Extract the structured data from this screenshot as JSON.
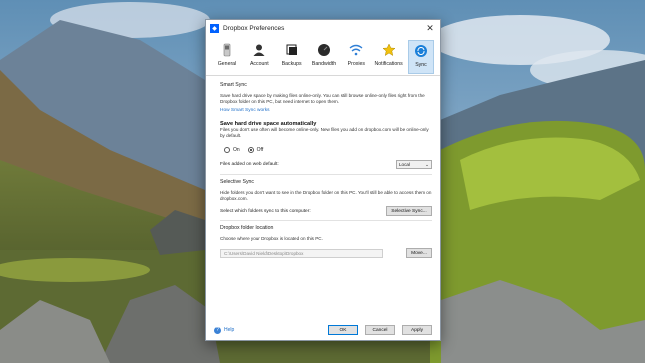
{
  "window": {
    "title": "Dropbox Preferences",
    "app_icon": "dropbox-logo",
    "close_label": "✕"
  },
  "toolbar": {
    "items": [
      {
        "label": "General",
        "icon": "switch-icon"
      },
      {
        "label": "Account",
        "icon": "person-icon"
      },
      {
        "label": "Backups",
        "icon": "backups-icon"
      },
      {
        "label": "Bandwidth",
        "icon": "gauge-icon"
      },
      {
        "label": "Proxies",
        "icon": "wifi-icon"
      },
      {
        "label": "Notifications",
        "icon": "star-icon"
      },
      {
        "label": "Sync",
        "icon": "sync-icon"
      }
    ],
    "active": "Sync"
  },
  "smart_sync": {
    "header": "Smart Sync",
    "description": "Save hard drive space by making files online-only. You can still browse online-only files right from the Dropbox folder on this PC, but need internet to open them.",
    "link": "How Smart Sync works",
    "bold_title": "Save hard drive space automatically",
    "bold_desc": "Files you don't use often will become online-only. New files you add on dropbox.com will be online-only by default.",
    "option_on": "On",
    "option_off": "Off",
    "selected": "Off",
    "files_default_label": "Files added on web default:",
    "files_default_value": "Local"
  },
  "selective_sync": {
    "header": "Selective Sync",
    "description": "Hide folders you don't want to see in the Dropbox folder on this PC. You'll still be able to access them on dropbox.com.",
    "select_label": "Select which folders sync to this computer:",
    "button_label": "Selective Sync..."
  },
  "folder_location": {
    "header": "Dropbox folder location",
    "description": "Choose where your Dropbox is located on this PC.",
    "path": "C:\\Users\\David Nield\\Desktop\\Dropbox",
    "button_label": "Move..."
  },
  "footer": {
    "help": "Help",
    "ok": "OK",
    "cancel": "Cancel",
    "apply": "Apply"
  },
  "colors": {
    "accent": "#0061fe",
    "link": "#1e6ec8",
    "active_tab": "#cfe4f7"
  }
}
